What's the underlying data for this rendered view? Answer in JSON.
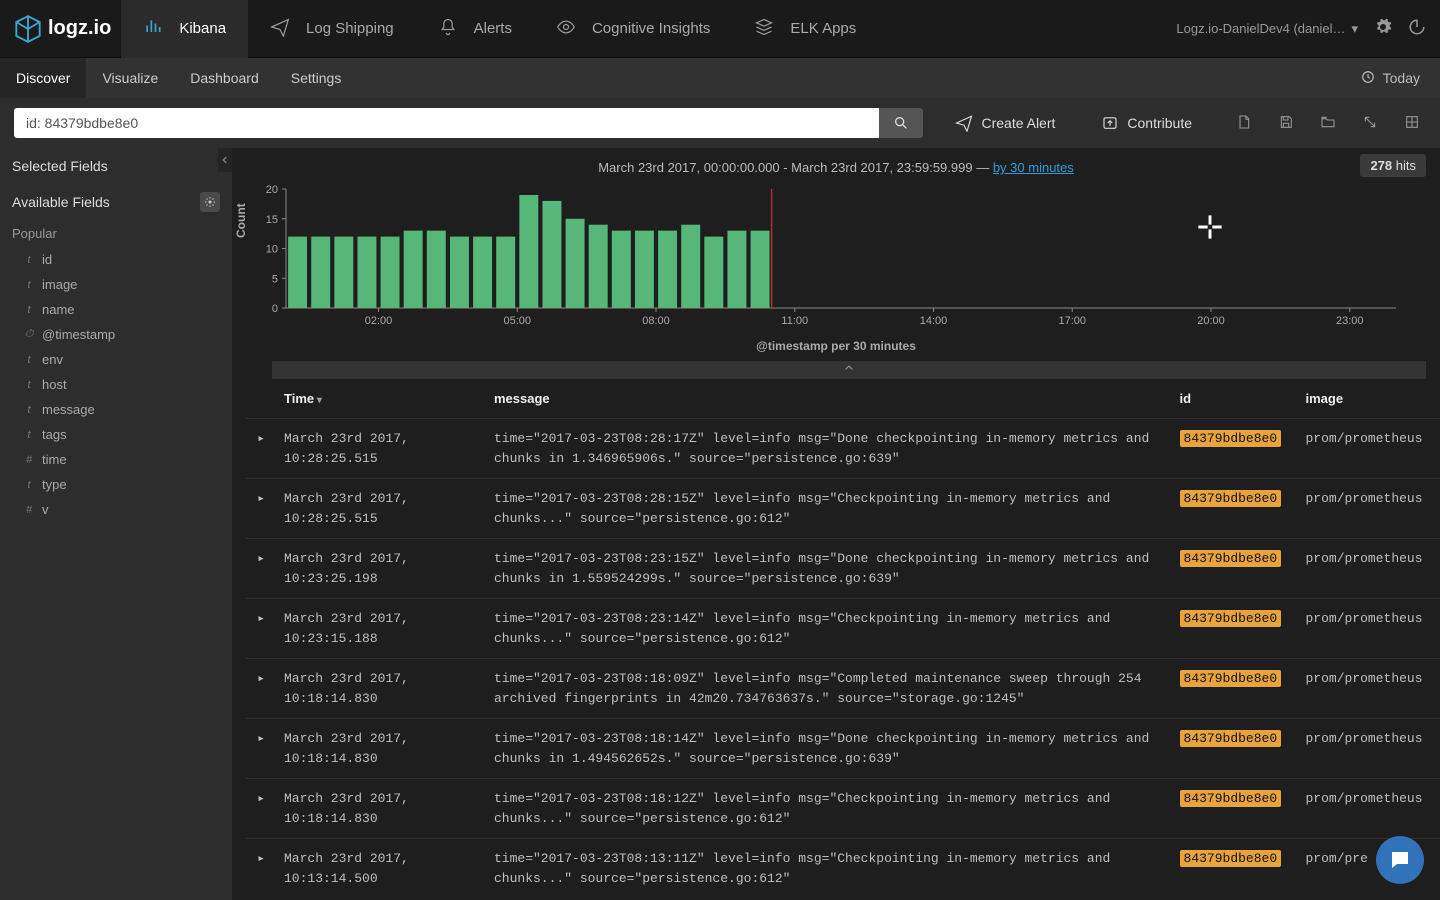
{
  "brand": "logz.io",
  "topnav": {
    "tabs": [
      {
        "label": "Kibana",
        "icon": "bars-icon",
        "active": true
      },
      {
        "label": "Log Shipping",
        "icon": "paperplane-icon"
      },
      {
        "label": "Alerts",
        "icon": "bell-icon"
      },
      {
        "label": "Cognitive Insights",
        "icon": "eye-icon"
      },
      {
        "label": "ELK Apps",
        "icon": "stack-icon"
      }
    ],
    "account": "Logz.io-DanielDev4 (daniel…"
  },
  "subnav": {
    "tabs": [
      "Discover",
      "Visualize",
      "Dashboard",
      "Settings"
    ],
    "active": "Discover",
    "time_label": "Today"
  },
  "query": {
    "value": "id: 84379bdbe8e0",
    "create_alert": "Create Alert",
    "contribute": "Contribute"
  },
  "sidebar": {
    "selected_label": "Selected Fields",
    "available_label": "Available Fields",
    "popular_label": "Popular",
    "fields": [
      {
        "t": "t",
        "name": "id"
      },
      {
        "t": "t",
        "name": "image"
      },
      {
        "t": "t",
        "name": "name"
      },
      {
        "t": "⏱",
        "name": "@timestamp"
      },
      {
        "t": "t",
        "name": "env"
      },
      {
        "t": "t",
        "name": "host"
      },
      {
        "t": "t",
        "name": "message"
      },
      {
        "t": "t",
        "name": "tags"
      },
      {
        "t": "#",
        "name": "time"
      },
      {
        "t": "t",
        "name": "type"
      },
      {
        "t": "#",
        "name": "v"
      }
    ]
  },
  "hits": {
    "count": "278",
    "label": "hits"
  },
  "chart_caption": {
    "range": "March 23rd 2017, 00:00:00.000 - March 23rd 2017, 23:59:59.999 — ",
    "link": "by 30 minutes"
  },
  "chart_data": {
    "type": "bar",
    "title": "",
    "xlabel": "@timestamp per 30 minutes",
    "ylabel": "Count",
    "ylim": [
      0,
      20
    ],
    "yticks": [
      0,
      5,
      10,
      15,
      20
    ],
    "xticks": [
      "02:00",
      "05:00",
      "08:00",
      "11:00",
      "14:00",
      "17:00",
      "20:00",
      "23:00"
    ],
    "categories": [
      "00:00",
      "00:30",
      "01:00",
      "01:30",
      "02:00",
      "02:30",
      "03:00",
      "03:30",
      "04:00",
      "04:30",
      "05:00",
      "05:30",
      "06:00",
      "06:30",
      "07:00",
      "07:30",
      "08:00",
      "08:30",
      "09:00",
      "09:30",
      "10:00"
    ],
    "values": [
      12,
      12,
      12,
      12,
      12,
      13,
      13,
      12,
      12,
      12,
      19,
      18,
      15,
      14,
      13,
      13,
      13,
      14,
      12,
      13,
      13
    ],
    "marker_after_index": 20
  },
  "table": {
    "columns": [
      "Time",
      "message",
      "id",
      "image"
    ],
    "rows": [
      {
        "time": "March 23rd 2017, 10:28:25.515",
        "message": "time=\"2017-03-23T08:28:17Z\" level=info msg=\"Done checkpointing in-memory metrics and chunks in 1.346965906s.\" source=\"persistence.go:639\"",
        "id": "84379bdbe8e0",
        "image": "prom/prometheus"
      },
      {
        "time": "March 23rd 2017, 10:28:25.515",
        "message": "time=\"2017-03-23T08:28:15Z\" level=info msg=\"Checkpointing in-memory metrics and chunks...\" source=\"persistence.go:612\"",
        "id": "84379bdbe8e0",
        "image": "prom/prometheus"
      },
      {
        "time": "March 23rd 2017, 10:23:25.198",
        "message": "time=\"2017-03-23T08:23:15Z\" level=info msg=\"Done checkpointing in-memory metrics and chunks in 1.559524299s.\" source=\"persistence.go:639\"",
        "id": "84379bdbe8e0",
        "image": "prom/prometheus"
      },
      {
        "time": "March 23rd 2017, 10:23:15.188",
        "message": "time=\"2017-03-23T08:23:14Z\" level=info msg=\"Checkpointing in-memory metrics and chunks...\" source=\"persistence.go:612\"",
        "id": "84379bdbe8e0",
        "image": "prom/prometheus"
      },
      {
        "time": "March 23rd 2017, 10:18:14.830",
        "message": "time=\"2017-03-23T08:18:09Z\" level=info msg=\"Completed maintenance sweep through 254 archived fingerprints in 42m20.734763637s.\" source=\"storage.go:1245\"",
        "id": "84379bdbe8e0",
        "image": "prom/prometheus"
      },
      {
        "time": "March 23rd 2017, 10:18:14.830",
        "message": "time=\"2017-03-23T08:18:14Z\" level=info msg=\"Done checkpointing in-memory metrics and chunks in 1.494562652s.\" source=\"persistence.go:639\"",
        "id": "84379bdbe8e0",
        "image": "prom/prometheus"
      },
      {
        "time": "March 23rd 2017, 10:18:14.830",
        "message": "time=\"2017-03-23T08:18:12Z\" level=info msg=\"Checkpointing in-memory metrics and chunks...\" source=\"persistence.go:612\"",
        "id": "84379bdbe8e0",
        "image": "prom/prometheus"
      },
      {
        "time": "March 23rd 2017, 10:13:14.500",
        "message": "time=\"2017-03-23T08:13:11Z\" level=info msg=\"Checkpointing in-memory metrics and chunks...\" source=\"persistence.go:612\"",
        "id": "84379bdbe8e0",
        "image": "prom/pre"
      }
    ]
  }
}
